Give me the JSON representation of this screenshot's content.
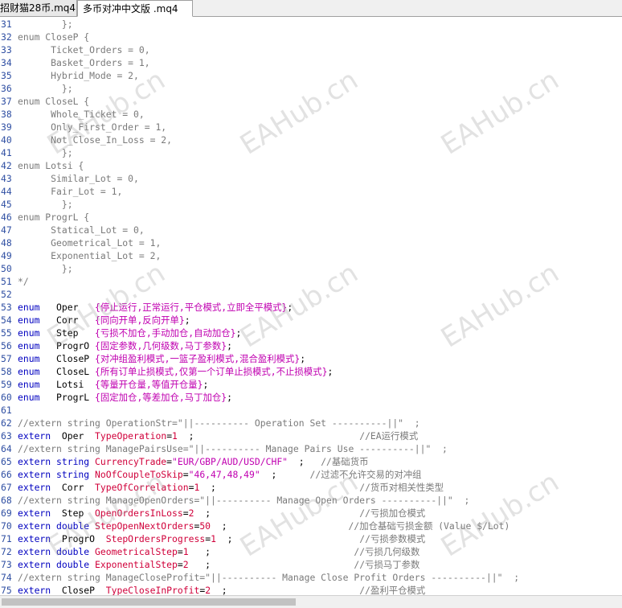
{
  "tabs": [
    {
      "label": "招财猫28币.mq4",
      "active": false
    },
    {
      "label": "多币对冲中文版 .mq4",
      "active": true
    }
  ],
  "watermark": "EAHub.cn",
  "colors": {
    "keyword": "#0000c0",
    "identifier": "#d0003a",
    "string_cn": "#c000b0",
    "comment": "#7a7a7a",
    "line_number": "#2e4ea2"
  },
  "lines": [
    {
      "n": "31",
      "segs": [
        {
          "t": "        };",
          "c": "g"
        }
      ]
    },
    {
      "n": "32",
      "segs": [
        {
          "t": "enum CloseP {",
          "c": "g"
        }
      ]
    },
    {
      "n": "33",
      "segs": [
        {
          "t": "      Ticket_Orders = 0,",
          "c": "g"
        }
      ]
    },
    {
      "n": "34",
      "segs": [
        {
          "t": "      Basket_Orders = 1,",
          "c": "g"
        }
      ]
    },
    {
      "n": "35",
      "segs": [
        {
          "t": "      Hybrid_Mode = 2,",
          "c": "g"
        }
      ]
    },
    {
      "n": "36",
      "segs": [
        {
          "t": "        };",
          "c": "g"
        }
      ]
    },
    {
      "n": "37",
      "segs": [
        {
          "t": "enum CloseL {",
          "c": "g"
        }
      ]
    },
    {
      "n": "38",
      "segs": [
        {
          "t": "      Whole_Ticket = 0,",
          "c": "g"
        }
      ]
    },
    {
      "n": "39",
      "segs": [
        {
          "t": "      Only_First_Order = 1,",
          "c": "g"
        }
      ]
    },
    {
      "n": "40",
      "segs": [
        {
          "t": "      Not_Close_In_Loss = 2,",
          "c": "g"
        }
      ]
    },
    {
      "n": "41",
      "segs": [
        {
          "t": "        };",
          "c": "g"
        }
      ]
    },
    {
      "n": "42",
      "segs": [
        {
          "t": "enum Lotsi {",
          "c": "g"
        }
      ]
    },
    {
      "n": "43",
      "segs": [
        {
          "t": "      Similar_Lot = 0,",
          "c": "g"
        }
      ]
    },
    {
      "n": "44",
      "segs": [
        {
          "t": "      Fair_Lot = 1,",
          "c": "g"
        }
      ]
    },
    {
      "n": "45",
      "segs": [
        {
          "t": "        };",
          "c": "g"
        }
      ]
    },
    {
      "n": "46",
      "segs": [
        {
          "t": "enum ProgrL {",
          "c": "g"
        }
      ]
    },
    {
      "n": "47",
      "segs": [
        {
          "t": "      Statical_Lot = 0,",
          "c": "g"
        }
      ]
    },
    {
      "n": "48",
      "segs": [
        {
          "t": "      Geometrical_Lot = 1,",
          "c": "g"
        }
      ]
    },
    {
      "n": "49",
      "segs": [
        {
          "t": "      Exponential_Lot = 2,",
          "c": "g"
        }
      ]
    },
    {
      "n": "50",
      "segs": [
        {
          "t": "        };",
          "c": "g"
        }
      ]
    },
    {
      "n": "51",
      "segs": [
        {
          "t": "*/",
          "c": "g"
        }
      ]
    },
    {
      "n": "52",
      "segs": []
    },
    {
      "n": "53",
      "segs": [
        {
          "t": "enum   ",
          "c": "k"
        },
        {
          "t": "Oper   ",
          "c": "b"
        },
        {
          "t": "{停止运行,正常运行,平仓模式,立即全平模式}",
          "c": "m"
        },
        {
          "t": ";",
          "c": "b"
        }
      ]
    },
    {
      "n": "54",
      "segs": [
        {
          "t": "enum   ",
          "c": "k"
        },
        {
          "t": "Corr   ",
          "c": "b"
        },
        {
          "t": "{同向开单,反向开单}",
          "c": "m"
        },
        {
          "t": ";",
          "c": "b"
        }
      ]
    },
    {
      "n": "55",
      "segs": [
        {
          "t": "enum   ",
          "c": "k"
        },
        {
          "t": "Step   ",
          "c": "b"
        },
        {
          "t": "{亏损不加仓,手动加仓,自动加仓}",
          "c": "m"
        },
        {
          "t": ";",
          "c": "b"
        }
      ]
    },
    {
      "n": "56",
      "segs": [
        {
          "t": "enum   ",
          "c": "k"
        },
        {
          "t": "ProgrO ",
          "c": "b"
        },
        {
          "t": "{固定参数,几何级数,马丁参数}",
          "c": "m"
        },
        {
          "t": ";",
          "c": "b"
        }
      ]
    },
    {
      "n": "57",
      "segs": [
        {
          "t": "enum   ",
          "c": "k"
        },
        {
          "t": "CloseP ",
          "c": "b"
        },
        {
          "t": "{对冲组盈利模式,一篮子盈利模式,混合盈利模式}",
          "c": "m"
        },
        {
          "t": ";",
          "c": "b"
        }
      ]
    },
    {
      "n": "58",
      "segs": [
        {
          "t": "enum   ",
          "c": "k"
        },
        {
          "t": "CloseL ",
          "c": "b"
        },
        {
          "t": "{所有订单止损模式,仅第一个订单止损模式,不止损模式}",
          "c": "m"
        },
        {
          "t": ";",
          "c": "b"
        }
      ]
    },
    {
      "n": "59",
      "segs": [
        {
          "t": "enum   ",
          "c": "k"
        },
        {
          "t": "Lotsi  ",
          "c": "b"
        },
        {
          "t": "{等量开仓量,等值开仓量}",
          "c": "m"
        },
        {
          "t": ";",
          "c": "b"
        }
      ]
    },
    {
      "n": "60",
      "segs": [
        {
          "t": "enum   ",
          "c": "k"
        },
        {
          "t": "ProgrL ",
          "c": "b"
        },
        {
          "t": "{固定加仓,等差加仓,马丁加仓}",
          "c": "m"
        },
        {
          "t": ";",
          "c": "b"
        }
      ]
    },
    {
      "n": "61",
      "segs": []
    },
    {
      "n": "62",
      "segs": [
        {
          "t": "//extern string OperationStr=\"||---------- Operation Set ----------||\"  ;",
          "c": "g"
        }
      ]
    },
    {
      "n": "63",
      "segs": [
        {
          "t": "extern  ",
          "c": "k"
        },
        {
          "t": "Oper  ",
          "c": "b"
        },
        {
          "t": "TypeOperation",
          "c": "r"
        },
        {
          "t": "=",
          "c": "b"
        },
        {
          "t": "1",
          "c": "r"
        },
        {
          "t": "  ;                              ",
          "c": "b"
        },
        {
          "t": "//EA运行模式",
          "c": "g"
        }
      ]
    },
    {
      "n": "64",
      "segs": [
        {
          "t": "//extern string ManagePairsUse=\"||---------- Manage Pairs Use ----------||\"  ;",
          "c": "g"
        }
      ]
    },
    {
      "n": "65",
      "segs": [
        {
          "t": "extern string ",
          "c": "k"
        },
        {
          "t": "CurrencyTrade",
          "c": "r"
        },
        {
          "t": "=",
          "c": "b"
        },
        {
          "t": "\"EUR/GBP/AUD/USD/CHF\"",
          "c": "m"
        },
        {
          "t": "  ;   ",
          "c": "b"
        },
        {
          "t": "//基础货币",
          "c": "g"
        }
      ]
    },
    {
      "n": "66",
      "segs": [
        {
          "t": "extern string ",
          "c": "k"
        },
        {
          "t": "NoOfCoupleToSkip",
          "c": "r"
        },
        {
          "t": "=",
          "c": "b"
        },
        {
          "t": "\"46,47,48,49\"",
          "c": "m"
        },
        {
          "t": "  ;      ",
          "c": "b"
        },
        {
          "t": "//过滤不允许交易的对冲组",
          "c": "g"
        }
      ]
    },
    {
      "n": "67",
      "segs": [
        {
          "t": "extern  ",
          "c": "k"
        },
        {
          "t": "Corr  ",
          "c": "b"
        },
        {
          "t": "TypeOfCorrelation",
          "c": "r"
        },
        {
          "t": "=",
          "c": "b"
        },
        {
          "t": "1",
          "c": "r"
        },
        {
          "t": "  ;                          ",
          "c": "b"
        },
        {
          "t": "//货币对相关性类型",
          "c": "g"
        }
      ]
    },
    {
      "n": "68",
      "segs": [
        {
          "t": "//extern string ManageOpenOrders=\"||---------- Manage Open Orders ----------||\"  ;",
          "c": "g"
        }
      ]
    },
    {
      "n": "69",
      "segs": [
        {
          "t": "extern  ",
          "c": "k"
        },
        {
          "t": "Step  ",
          "c": "b"
        },
        {
          "t": "OpenOrdersInLoss",
          "c": "r"
        },
        {
          "t": "=",
          "c": "b"
        },
        {
          "t": "2",
          "c": "r"
        },
        {
          "t": "  ;                           ",
          "c": "b"
        },
        {
          "t": "//亏损加仓模式",
          "c": "g"
        }
      ]
    },
    {
      "n": "70",
      "segs": [
        {
          "t": "extern double ",
          "c": "k"
        },
        {
          "t": "StepOpenNextOrders",
          "c": "r"
        },
        {
          "t": "=",
          "c": "b"
        },
        {
          "t": "50",
          "c": "r"
        },
        {
          "t": "  ;                      ",
          "c": "b"
        },
        {
          "t": "//加仓基础亏损金额 (Value $/Lot)",
          "c": "g"
        }
      ]
    },
    {
      "n": "71",
      "segs": [
        {
          "t": "extern  ",
          "c": "k"
        },
        {
          "t": "ProgrO  ",
          "c": "b"
        },
        {
          "t": "StepOrdersProgress",
          "c": "r"
        },
        {
          "t": "=",
          "c": "b"
        },
        {
          "t": "1",
          "c": "r"
        },
        {
          "t": "  ;                       ",
          "c": "b"
        },
        {
          "t": "//亏损参数模式",
          "c": "g"
        }
      ]
    },
    {
      "n": "72",
      "segs": [
        {
          "t": "extern double ",
          "c": "k"
        },
        {
          "t": "GeometricalStep",
          "c": "r"
        },
        {
          "t": "=",
          "c": "b"
        },
        {
          "t": "1",
          "c": "r"
        },
        {
          "t": "   ;                          ",
          "c": "b"
        },
        {
          "t": "//亏损几何级数",
          "c": "g"
        }
      ]
    },
    {
      "n": "73",
      "segs": [
        {
          "t": "extern double ",
          "c": "k"
        },
        {
          "t": "ExponentialStep",
          "c": "r"
        },
        {
          "t": "=",
          "c": "b"
        },
        {
          "t": "2",
          "c": "r"
        },
        {
          "t": "   ;                          ",
          "c": "b"
        },
        {
          "t": "//亏损马丁参数",
          "c": "g"
        }
      ]
    },
    {
      "n": "74",
      "segs": [
        {
          "t": "//extern string ManageCloseProfit=\"||---------- Manage Close Profit Orders ----------||\"  ;",
          "c": "g"
        }
      ]
    },
    {
      "n": "75",
      "segs": [
        {
          "t": "extern  ",
          "c": "k"
        },
        {
          "t": "CloseP  ",
          "c": "b"
        },
        {
          "t": "TypeCloseInProfit",
          "c": "r"
        },
        {
          "t": "=",
          "c": "b"
        },
        {
          "t": "2",
          "c": "r"
        },
        {
          "t": "  ;                        ",
          "c": "b"
        },
        {
          "t": "//盈利平仓模式",
          "c": "g"
        }
      ]
    }
  ]
}
